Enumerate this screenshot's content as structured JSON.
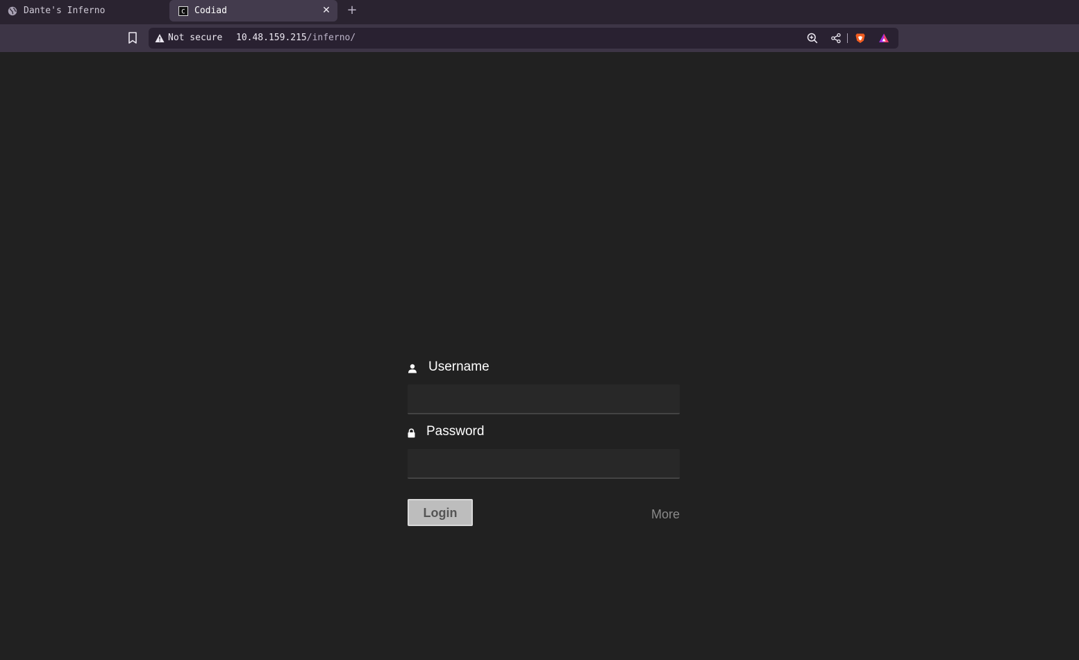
{
  "browser": {
    "tabs": [
      {
        "title": "Dante's Inferno",
        "favicon": "globe-icon",
        "active": false
      },
      {
        "title": "Codiad",
        "favicon": "codiad-icon",
        "active": true
      }
    ],
    "new_tab_icon": "plus-icon",
    "close_tab_icon": "close-icon",
    "security_label": "Not secure",
    "url_host": "10.48.159.215",
    "url_path": "/inferno/",
    "toolbar_icons": [
      "bookmark-icon",
      "warning-icon",
      "zoom-icon",
      "share-icon",
      "brave-shields-icon",
      "brave-rewards-icon"
    ]
  },
  "login": {
    "username_label": "Username",
    "username_value": "",
    "password_label": "Password",
    "password_value": "",
    "login_button": "Login",
    "more_link": "More"
  },
  "colors": {
    "page_background": "#212121",
    "tab_bar": "#2a2330",
    "active_tab": "#433b4d",
    "toolbar": "#3d3546",
    "url_bar": "#292131",
    "input_background": "#282828",
    "button_background": "#bdbdbd",
    "more_link": "#8a8a8a"
  }
}
